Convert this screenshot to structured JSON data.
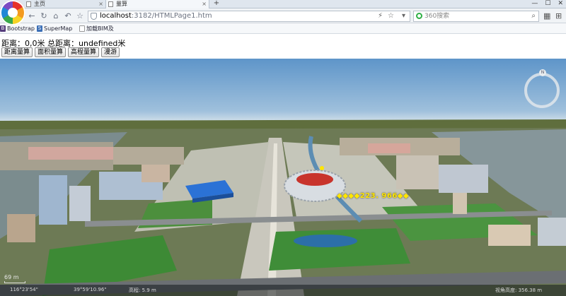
{
  "browser": {
    "tabs": [
      {
        "label": "主页"
      },
      {
        "label": "量算"
      }
    ],
    "new_tab_label": "+",
    "address": {
      "host": "localhost",
      "path": ":3182/HTMLPage1.htm"
    },
    "search_placeholder": "360搜索",
    "bookmarks": [
      {
        "icon_text": "B",
        "label": "Bootstrap"
      },
      {
        "icon_text": "S",
        "label": "SuperMap"
      },
      {
        "icon_text": "",
        "label": "加载BIM及"
      }
    ]
  },
  "page": {
    "distance_label": "距离：",
    "distance_value": "0,0米",
    "total_label": "总距离：",
    "total_value": "undefined米",
    "buttons": [
      {
        "label": "距离量算"
      },
      {
        "label": "面积量算"
      },
      {
        "label": "高程量算"
      },
      {
        "label": "漫游"
      }
    ]
  },
  "viewport": {
    "measure_label": "◆◆◆◆223. 966◆◆",
    "compass_letter": "N",
    "scale_label": "69 m",
    "status_items": [
      "116°23'54\"",
      "39°59'10.96\"",
      "高程: 5.9 m",
      "视角高度: 356.38 m"
    ],
    "colors": {
      "sky_top": "#5e95c9",
      "ground": "#5f6e3d",
      "stadium_bowl": "#d8dde2",
      "stadium_field": "#c8342c",
      "water_cube": "#2b72d6",
      "grass": "#3d8a35",
      "label": "#ffe600"
    }
  }
}
